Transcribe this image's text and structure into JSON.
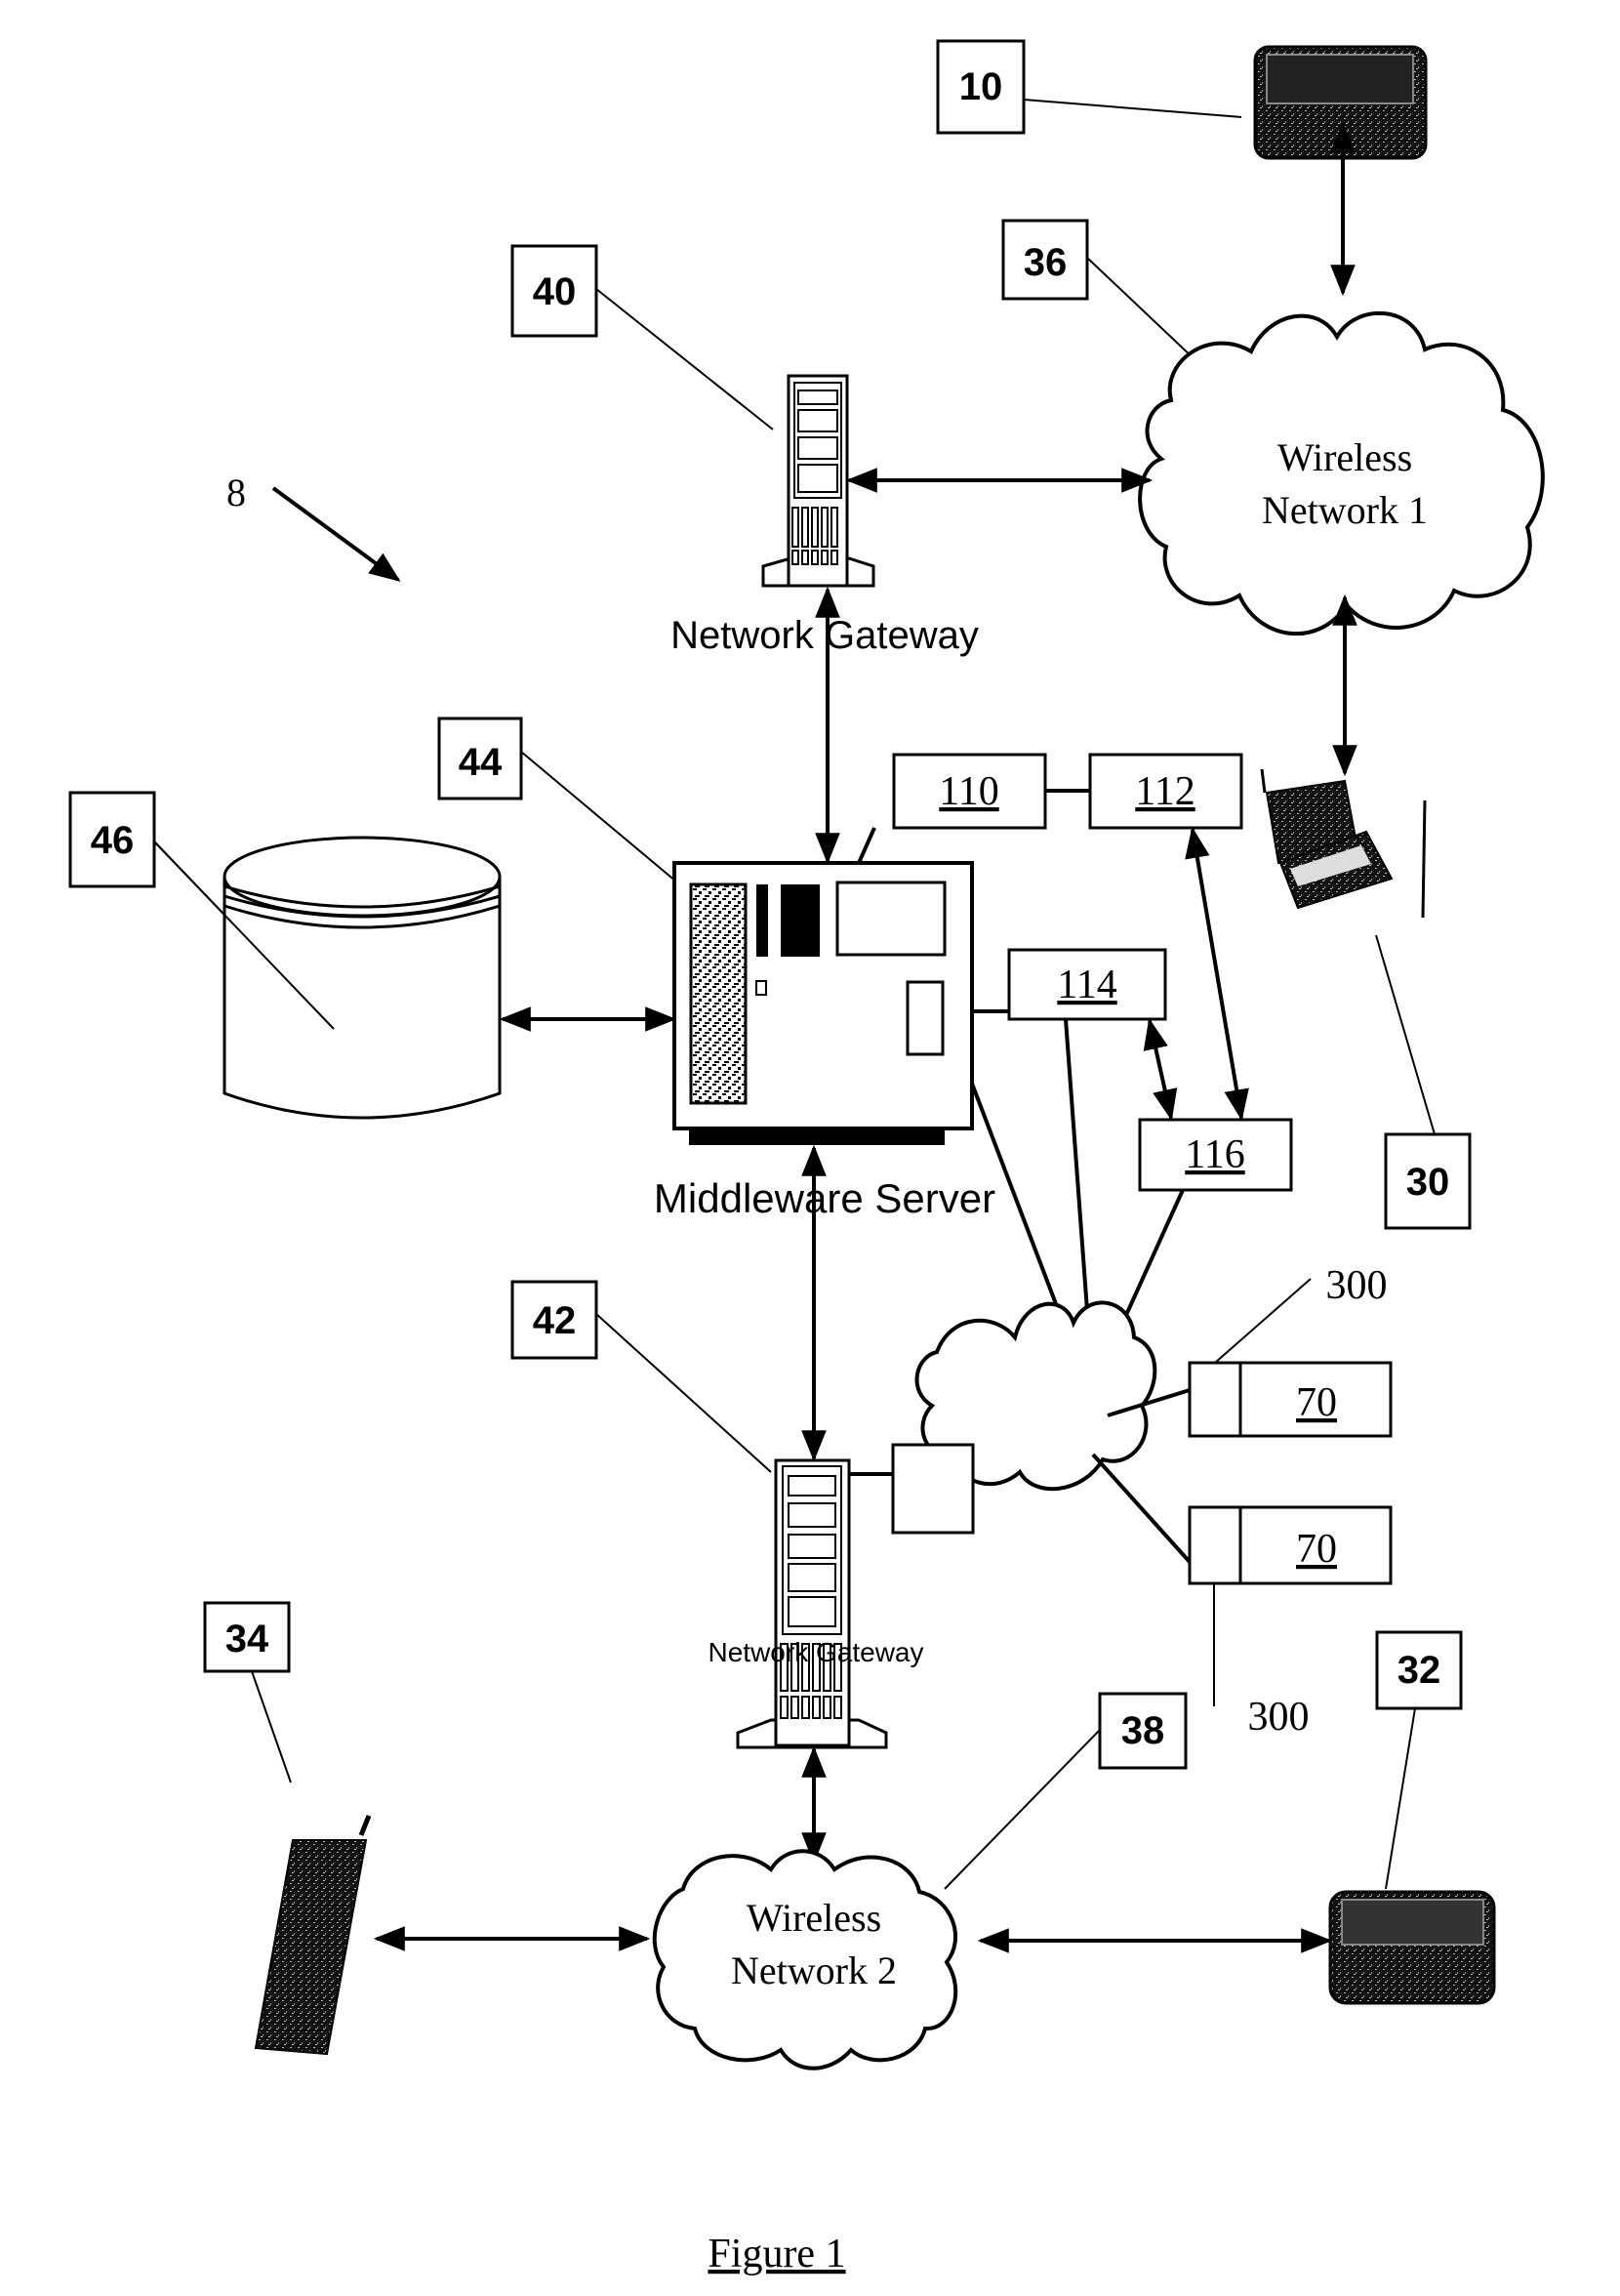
{
  "figure": {
    "caption": "Figure 1",
    "system_ref": "8"
  },
  "reference_boxes": {
    "ref_10": "10",
    "ref_36": "36",
    "ref_40": "40",
    "ref_44": "44",
    "ref_46": "46",
    "ref_42": "42",
    "ref_30": "30",
    "ref_34": "34",
    "ref_32": "32",
    "ref_38": "38"
  },
  "component_boxes": {
    "box_110": "110",
    "box_112": "112",
    "box_114": "114",
    "box_116": "116",
    "box_70_a": "70",
    "box_70_b": "70"
  },
  "callouts": {
    "label_300_top": "300",
    "label_300_bottom": "300"
  },
  "nodes": {
    "wireless_network_1": {
      "line1": "Wireless",
      "line2": "Network 1"
    },
    "wireless_network_2": {
      "line1": "Wireless",
      "line2": "Network 2"
    },
    "gateway_top_label": "Network Gateway",
    "gateway_bottom_label": "Network Gateway",
    "middleware_label": "Middleware Server"
  },
  "icons": [
    "pager-icon",
    "laptop-icon",
    "mobile-phone-icon",
    "server-tower-icon",
    "database-icon",
    "middleware-server-icon",
    "cloud-icon"
  ]
}
